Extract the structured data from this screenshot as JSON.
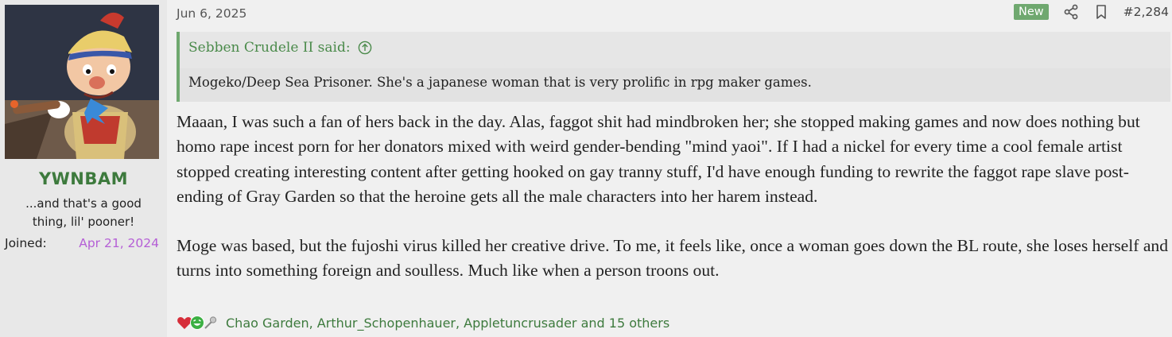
{
  "user": {
    "name": "YWNBAM",
    "title": "...and that's a good thing, lil' pooner!",
    "joined_label": "Joined:",
    "joined_date": "Apr 21, 2024",
    "name_color": "#3d7a3d",
    "date_color": "#b55fd6"
  },
  "post": {
    "date": "Jun 6, 2025",
    "new_badge": "New",
    "number": "#2,284",
    "quote": {
      "author": "Sebben Crudele II said:",
      "text": "Mogeko/Deep Sea Prisoner. She's a japanese woman that is very prolific in rpg maker games."
    },
    "paragraphs": [
      "Maaan, I was such a fan of hers back in the day. Alas, faggot shit had mindbroken her; she stopped making games and now does nothing but homo rape incest porn for her donators mixed with weird gender-bending \"mind yaoi\". If I had a nickel for every time a cool female artist stopped creating interesting content after getting hooked on gay tranny stuff, I'd have enough funding to rewrite the faggot rape slave post-ending of Gray Garden so that the heroine gets all the male characters into her harem instead.",
      "Moge was based, but the fujoshi virus killed her creative drive. To me, it feels like, once a woman goes down the BL route, she loses herself and turns into something foreign and soulless. Much like when a person troons out."
    ],
    "reactions": {
      "icons": [
        "heart-icon",
        "laughing-face-icon",
        "microphone-icon"
      ],
      "text": "Chao Garden, Arthur_Schopenhauer, Appletuncrusader and 15 others"
    },
    "accent_color": "#6fa86f"
  }
}
